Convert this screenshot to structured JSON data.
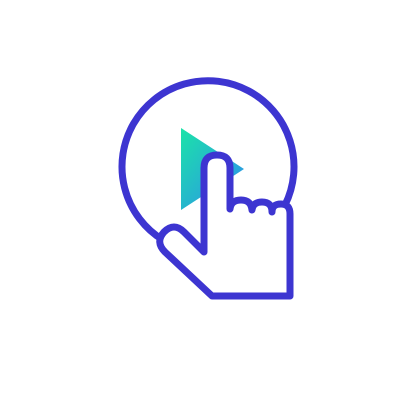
{
  "icon": {
    "name": "tap-to-play-icon",
    "parts": [
      "circle-outline",
      "play-triangle",
      "pointing-hand"
    ],
    "colors": {
      "stroke": "#3D35D1",
      "play_gradient_start": "#1BE3A8",
      "play_gradient_end": "#2F8BF0",
      "background": "#FFFFFF"
    }
  }
}
